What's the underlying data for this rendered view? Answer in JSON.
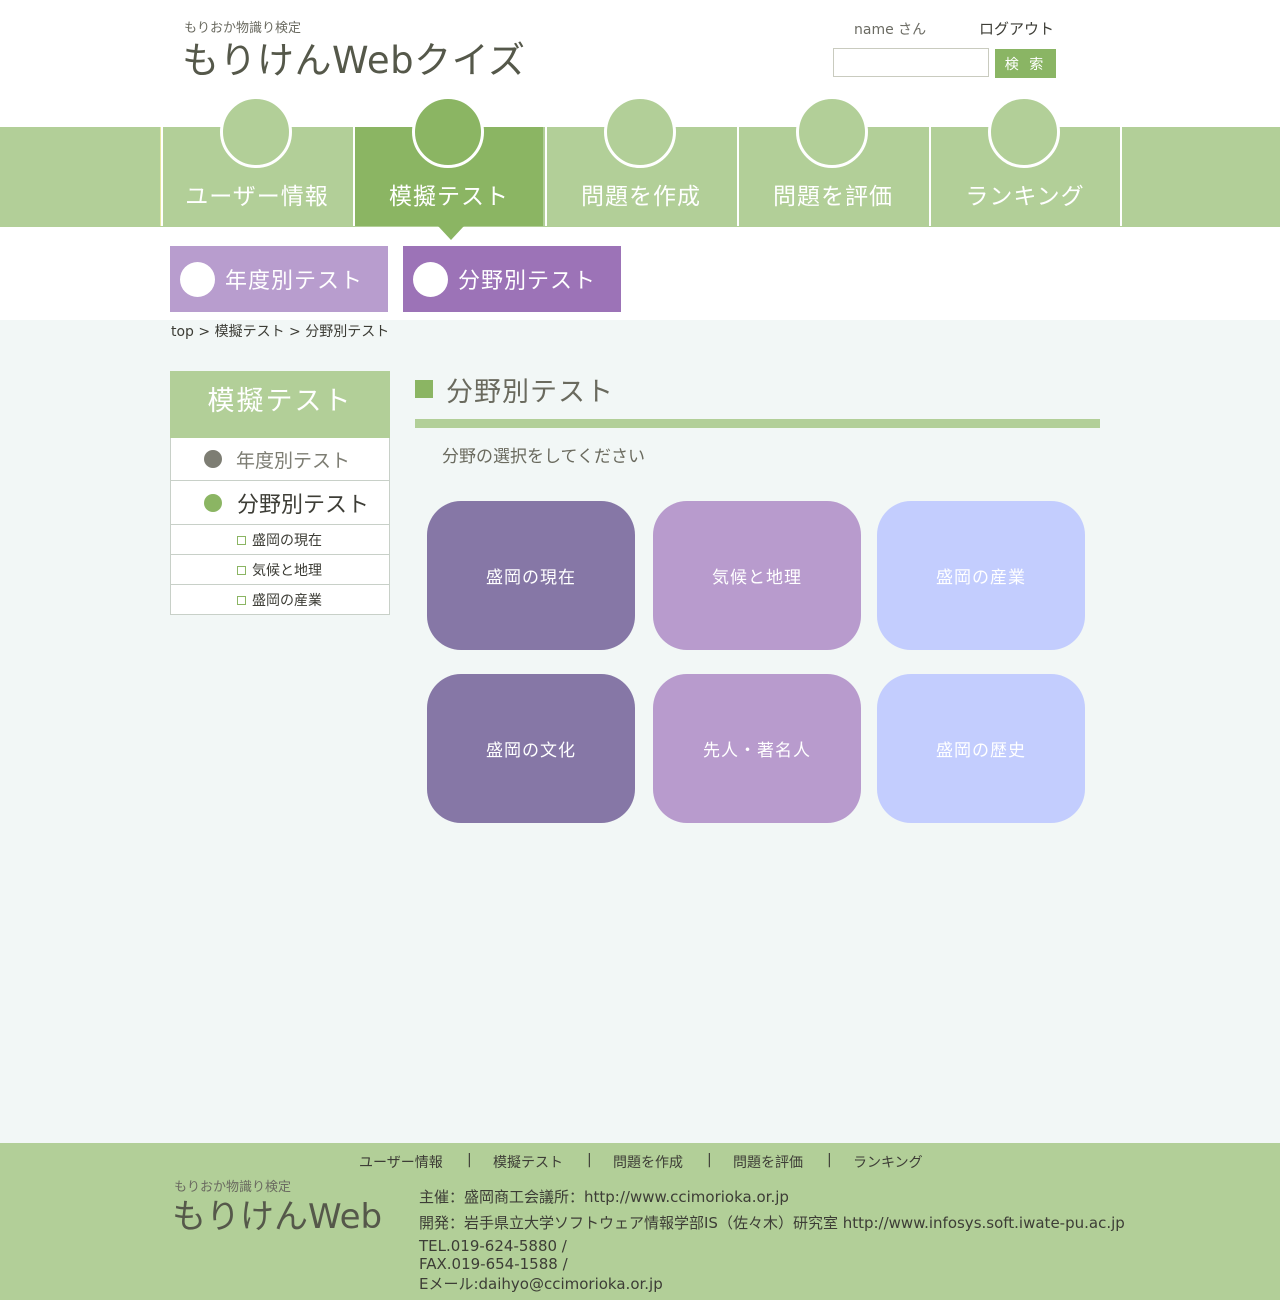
{
  "header": {
    "subtitle": "もりおか物識り検定",
    "title": "もりけんWebクイズ",
    "user_name": "name さん",
    "logout": "ログアウト",
    "search_placeholder": "",
    "search_button": "検 索"
  },
  "nav": {
    "tabs": [
      {
        "label": "ユーザー情報"
      },
      {
        "label": "模擬テスト",
        "active": true
      },
      {
        "label": "問題を作成"
      },
      {
        "label": "問題を評価"
      },
      {
        "label": "ランキング"
      }
    ]
  },
  "subnav": {
    "items": [
      {
        "label": "年度別テスト",
        "color": "#b89dce"
      },
      {
        "label": "分野別テスト",
        "color": "#9c73b7",
        "active": true
      }
    ]
  },
  "breadcrumb": {
    "top": "top",
    "sep1": " > ",
    "section": "模擬テスト",
    "sep2": " > ",
    "current": "分野別テスト"
  },
  "sidebar": {
    "heading": "模擬テスト",
    "items": [
      {
        "label": "年度別テスト",
        "bullet_color": "#7d7d73"
      },
      {
        "label": "分野別テスト",
        "bullet_color": "#8bb563",
        "active": true
      }
    ],
    "subitems": [
      {
        "label": "盛岡の現在"
      },
      {
        "label": "気候と地理"
      },
      {
        "label": "盛岡の産業"
      }
    ]
  },
  "main": {
    "title": "分野別テスト",
    "instruction": "分野の選択をしてください",
    "categories": [
      {
        "label": "盛岡の現在",
        "color": "#8677a6"
      },
      {
        "label": "気候と地理",
        "color": "#b89bcd"
      },
      {
        "label": "盛岡の産業",
        "color": "#c3cdfe"
      },
      {
        "label": "盛岡の文化",
        "color": "#8677a6"
      },
      {
        "label": "先人・著名人",
        "color": "#b89bcd"
      },
      {
        "label": "盛岡の歴史",
        "color": "#c3cdfe"
      }
    ]
  },
  "footer": {
    "nav": [
      "ユーザー情報",
      "模擬テスト",
      "問題を作成",
      "問題を評価",
      "ランキング"
    ],
    "separator": "|",
    "subtitle": "もりおか物識り検定",
    "logo": "もりけんWeb",
    "sponsor": "主催：盛岡商工会議所：http://www.ccimorioka.or.jp",
    "developer": "開発：岩手県立大学ソフトウェア情報学部IS（佐々木）研究室  http://www.infosys.soft.iwate-pu.ac.jp",
    "tel": "TEL.019-624-5880 /",
    "fax": "FAX.019-654-1588 /",
    "email": "Eメール:daihyo@ccimorioka.or.jp"
  },
  "colors": {
    "brand_green": "#b2cf98",
    "active_green": "#8bb563",
    "content_bg": "#f2f7f6"
  }
}
